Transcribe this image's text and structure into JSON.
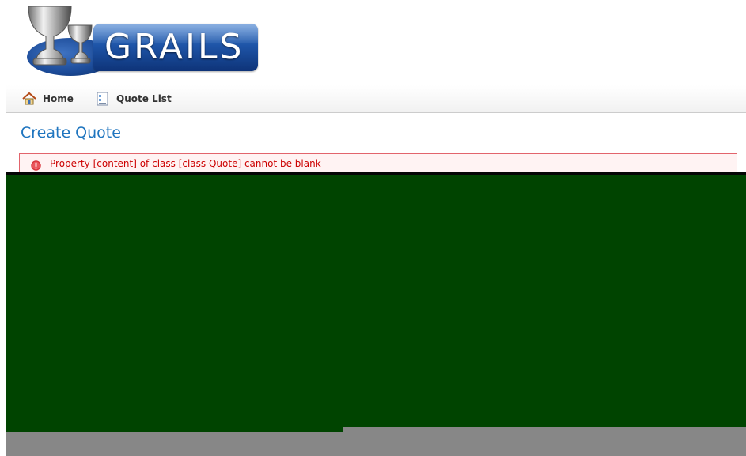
{
  "logo": {
    "text": "GRAILS",
    "icon": "grails-chalice-icon"
  },
  "nav": {
    "items": [
      {
        "label": "Home",
        "icon": "home-icon"
      },
      {
        "label": "Quote List",
        "icon": "list-icon"
      }
    ]
  },
  "page": {
    "title": "Create Quote"
  },
  "errors": [
    {
      "message": "Property [content] of class [class Quote] cannot be blank",
      "icon": "error-icon"
    }
  ],
  "colors": {
    "title": "#1f75bf",
    "error_text": "#cc0000",
    "error_border": "#e2646c",
    "redacted_fill": "#004400",
    "footer_fill": "#878787"
  }
}
